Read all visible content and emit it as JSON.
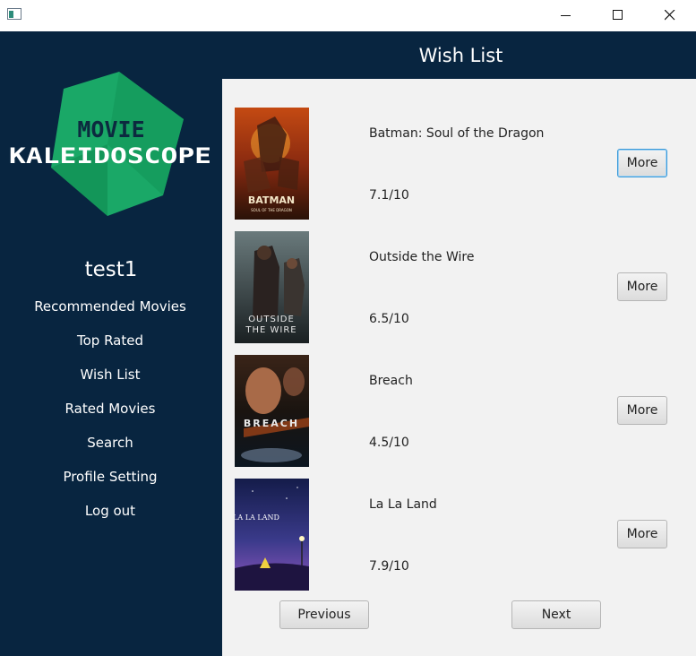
{
  "window": {
    "title": ""
  },
  "header": {
    "title": "Wish List"
  },
  "sidebar": {
    "logo_line1": "MOVIE",
    "logo_line2": "KALEIDOSCOPE",
    "username": "test1",
    "items": [
      {
        "label": "Recommended Movies"
      },
      {
        "label": "Top Rated"
      },
      {
        "label": "Wish List"
      },
      {
        "label": "Rated Movies"
      },
      {
        "label": "Search"
      },
      {
        "label": "Profile Setting"
      },
      {
        "label": "Log out"
      }
    ]
  },
  "movies": [
    {
      "title": "Batman: Soul of the Dragon",
      "rating": "7.1/10",
      "more_label": "More",
      "poster_text_line1": "BATMAN",
      "poster_text_line2": "SOUL OF THE DRAGON"
    },
    {
      "title": "Outside the Wire",
      "rating": "6.5/10",
      "more_label": "More",
      "poster_text_line1": "OUTSIDE",
      "poster_text_line2": "THE WIRE"
    },
    {
      "title": "Breach",
      "rating": "4.5/10",
      "more_label": "More",
      "poster_text_line1": "BREACH",
      "poster_text_line2": ""
    },
    {
      "title": "La La Land",
      "rating": "7.9/10",
      "more_label": "More",
      "poster_text_line1": "LA LA LAND",
      "poster_text_line2": ""
    }
  ],
  "pagination": {
    "previous_label": "Previous",
    "next_label": "Next"
  },
  "colors": {
    "sidebar_bg": "#082540",
    "content_bg": "#f2f2f2",
    "logo_green": "#1aa867",
    "focus_blue": "#3a9ad9"
  },
  "icons": [
    "app-icon",
    "minimize-icon",
    "maximize-icon",
    "close-icon"
  ]
}
